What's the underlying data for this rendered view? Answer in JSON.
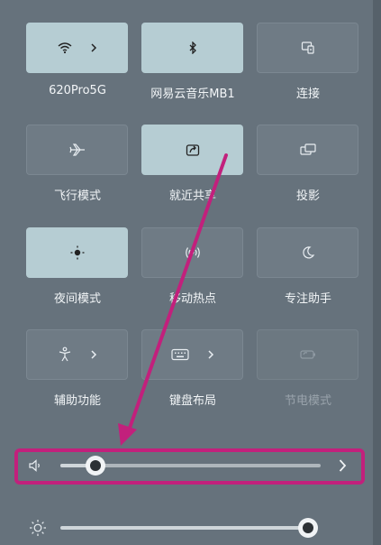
{
  "tiles": [
    {
      "label": "620Pro5G",
      "icon": "wifi-icon",
      "state": "on",
      "chevron": true
    },
    {
      "label": "网易云音乐MB1",
      "icon": "bluetooth-icon",
      "state": "on",
      "chevron": false
    },
    {
      "label": "连接",
      "icon": "cast-icon",
      "state": "off",
      "chevron": false
    },
    {
      "label": "飞行模式",
      "icon": "airplane-icon",
      "state": "off",
      "chevron": false
    },
    {
      "label": "就近共享",
      "icon": "share-icon",
      "state": "on",
      "chevron": false
    },
    {
      "label": "投影",
      "icon": "project-icon",
      "state": "off",
      "chevron": false
    },
    {
      "label": "夜间模式",
      "icon": "night-light-icon",
      "state": "on",
      "chevron": false
    },
    {
      "label": "移动热点",
      "icon": "hotspot-icon",
      "state": "off",
      "chevron": false
    },
    {
      "label": "专注助手",
      "icon": "moon-icon",
      "state": "off",
      "chevron": false
    },
    {
      "label": "辅助功能",
      "icon": "accessibility-icon",
      "state": "off",
      "chevron": true
    },
    {
      "label": "键盘布局",
      "icon": "keyboard-icon",
      "state": "off",
      "chevron": true
    },
    {
      "label": "节电模式",
      "icon": "battery-saver-icon",
      "state": "disabled",
      "chevron": false
    }
  ],
  "volume": {
    "icon": "speaker-icon",
    "level": 0.1
  },
  "brightness": {
    "icon": "sun-icon",
    "level": 0.98
  },
  "colors": {
    "accent": "#b6cdd3",
    "annotation": "#c2207c"
  }
}
